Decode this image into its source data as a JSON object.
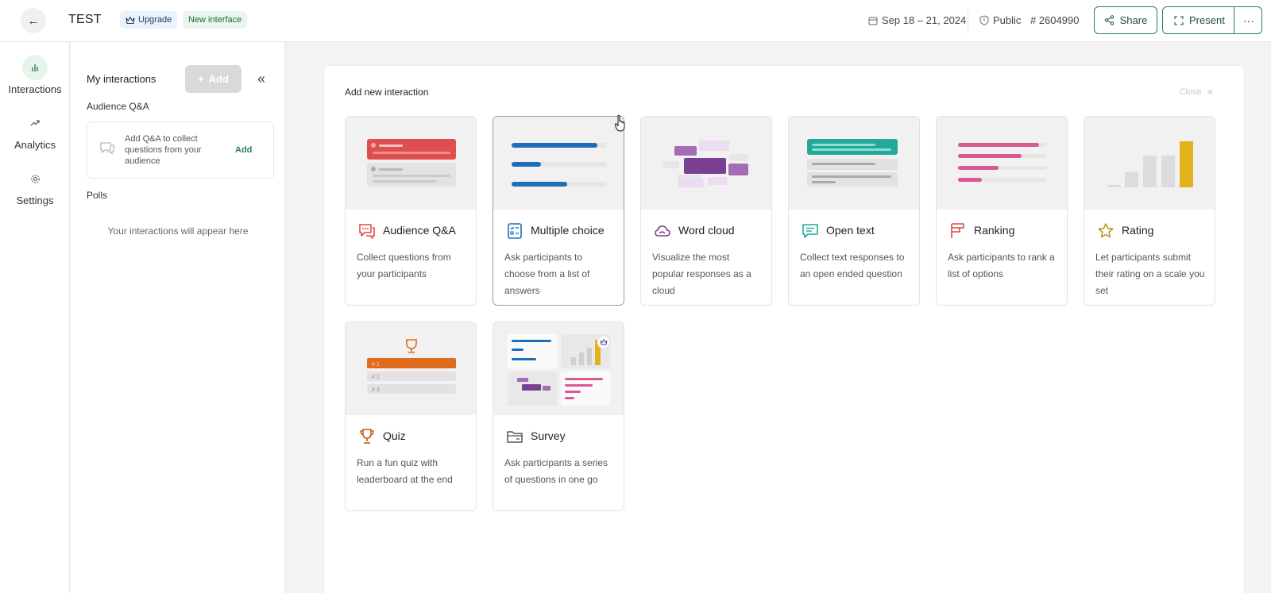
{
  "header": {
    "back_icon": "arrow-left-icon",
    "title": "TEST",
    "upgrade_label": "Upgrade",
    "new_interface_label": "New interface",
    "date_label": "Sep 18 – 21, 2024",
    "visibility_label": "Public",
    "code_label": "# 2604990",
    "share_label": "Share",
    "present_label": "Present",
    "more_label": "···"
  },
  "rail": {
    "items": [
      {
        "label": "Interactions",
        "icon": "bar-chart-icon",
        "active": true
      },
      {
        "label": "Analytics",
        "icon": "trend-icon",
        "active": false
      },
      {
        "label": "Settings",
        "icon": "gear-icon",
        "active": false
      }
    ]
  },
  "panel": {
    "heading": "My interactions",
    "add_label": "Add",
    "qa_section": "Audience Q&A",
    "qa_text": "Add Q&A to collect questions from your audience",
    "qa_add_label": "Add",
    "polls_section": "Polls",
    "empty_note": "Your interactions will appear here"
  },
  "main": {
    "title": "Add new interaction",
    "close_label": "Close",
    "cards": [
      {
        "title": "Audience Q&A",
        "desc": "Collect questions from your participants",
        "accent": "#d94b4b"
      },
      {
        "title": "Multiple choice",
        "desc": "Ask participants to choose from a list of answers",
        "accent": "#1f6fb8"
      },
      {
        "title": "Word cloud",
        "desc": "Visualize the most popular responses as a cloud",
        "accent": "#7b3f91"
      },
      {
        "title": "Open text",
        "desc": "Collect text responses to an open ended question",
        "accent": "#22a99a"
      },
      {
        "title": "Ranking",
        "desc": "Ask participants to rank a list of options",
        "accent": "#d95a93"
      },
      {
        "title": "Rating",
        "desc": "Let participants submit their rating on a scale you set",
        "accent": "#e2b21c"
      },
      {
        "title": "Quiz",
        "desc": "Run a fun quiz with leaderboard at the end",
        "accent": "#e06a1e"
      },
      {
        "title": "Survey",
        "desc": "Ask participants a series of questions in one go",
        "accent": "#777777"
      }
    ],
    "quiz_ranks": [
      "# 1",
      "# 2",
      "# 3"
    ]
  }
}
